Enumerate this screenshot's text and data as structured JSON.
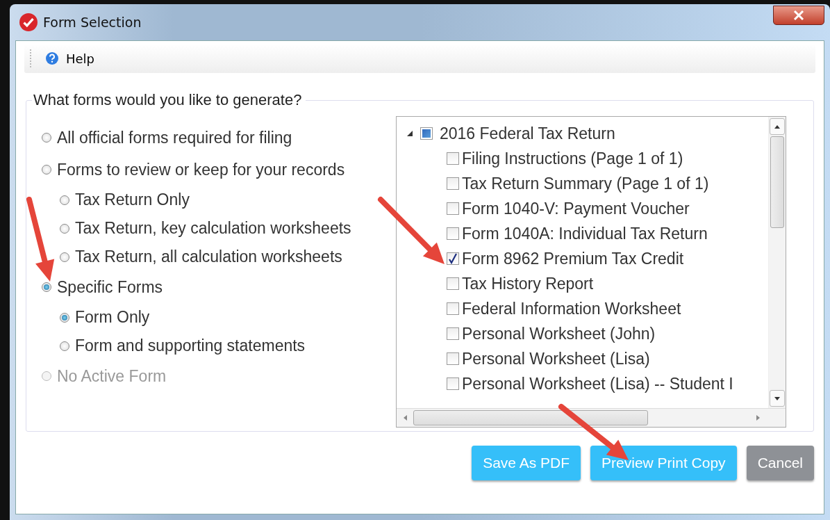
{
  "window": {
    "title": "Form Selection"
  },
  "toolbar": {
    "help": "Help"
  },
  "group": {
    "legend": "What forms would you like to generate?"
  },
  "options": [
    {
      "label": "All official forms required for filing",
      "selected": false,
      "disabled": false
    },
    {
      "label": "Forms to review or keep for your records",
      "selected": false,
      "disabled": false,
      "children": [
        {
          "label": "Tax Return Only",
          "selected": false
        },
        {
          "label": "Tax Return, key calculation worksheets",
          "selected": false
        },
        {
          "label": "Tax Return, all calculation worksheets",
          "selected": false
        }
      ]
    },
    {
      "label": "Specific Forms",
      "selected": true,
      "disabled": false,
      "children": [
        {
          "label": "Form Only",
          "selected": true
        },
        {
          "label": "Form and supporting statements",
          "selected": false
        }
      ]
    },
    {
      "label": "No Active Form",
      "selected": false,
      "disabled": true
    }
  ],
  "tree": {
    "label": "2016 Federal Tax Return",
    "expanded": true,
    "partial": true,
    "children": [
      {
        "label": "Filing Instructions (Page 1 of 1)",
        "checked": false
      },
      {
        "label": "Tax Return Summary (Page 1 of 1)",
        "checked": false
      },
      {
        "label": "Form 1040-V: Payment Voucher",
        "checked": false
      },
      {
        "label": "Form 1040A: Individual Tax Return",
        "checked": false
      },
      {
        "label": "Form 8962 Premium Tax Credit",
        "checked": true
      },
      {
        "label": "Tax History Report",
        "checked": false
      },
      {
        "label": "Federal Information Worksheet",
        "checked": false
      },
      {
        "label": "Personal Worksheet (John)",
        "checked": false
      },
      {
        "label": "Personal Worksheet (Lisa)",
        "checked": false
      },
      {
        "label": "Personal Worksheet (Lisa) -- Student I",
        "checked": false
      }
    ]
  },
  "buttons": [
    {
      "label": "Save As PDF",
      "kind": "primary"
    },
    {
      "label": "Preview Print Copy",
      "kind": "primary"
    },
    {
      "label": "Cancel",
      "kind": "secondary"
    }
  ]
}
